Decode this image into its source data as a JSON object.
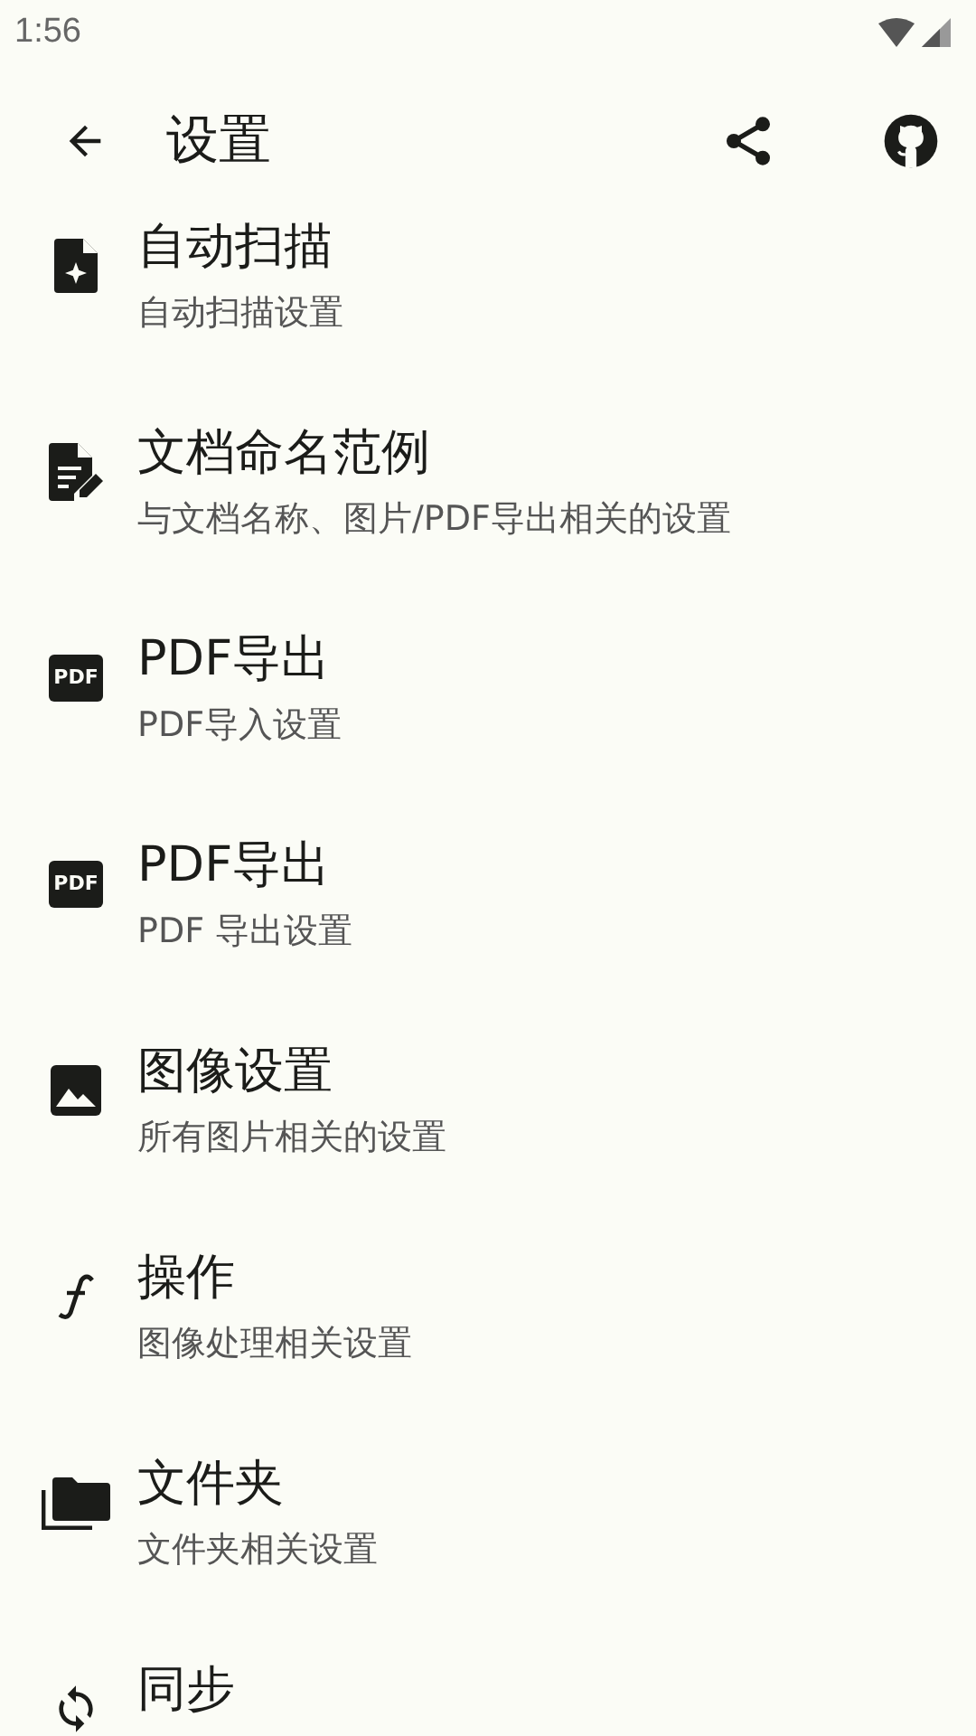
{
  "status_bar": {
    "time": "1:56"
  },
  "toolbar": {
    "title": "设置"
  },
  "items": [
    {
      "kind": "auto-scan",
      "title": "自动扫描",
      "subtitle": "自动扫描设置"
    },
    {
      "kind": "edit-doc",
      "title": "文档命名范例",
      "subtitle": "与文档名称、图片/PDF导出相关的设置"
    },
    {
      "kind": "pdf",
      "icon_text": "PDF",
      "title": "PDF导出",
      "subtitle": "PDF导入设置"
    },
    {
      "kind": "pdf",
      "icon_text": "PDF",
      "title": "PDF导出",
      "subtitle": "PDF 导出设置"
    },
    {
      "kind": "image",
      "title": "图像设置",
      "subtitle": "所有图片相关的设置"
    },
    {
      "kind": "function",
      "title": "操作",
      "subtitle": "图像处理相关设置"
    },
    {
      "kind": "folder",
      "title": "文件夹",
      "subtitle": "文件夹相关设置"
    },
    {
      "kind": "sync",
      "title": "同步"
    }
  ]
}
